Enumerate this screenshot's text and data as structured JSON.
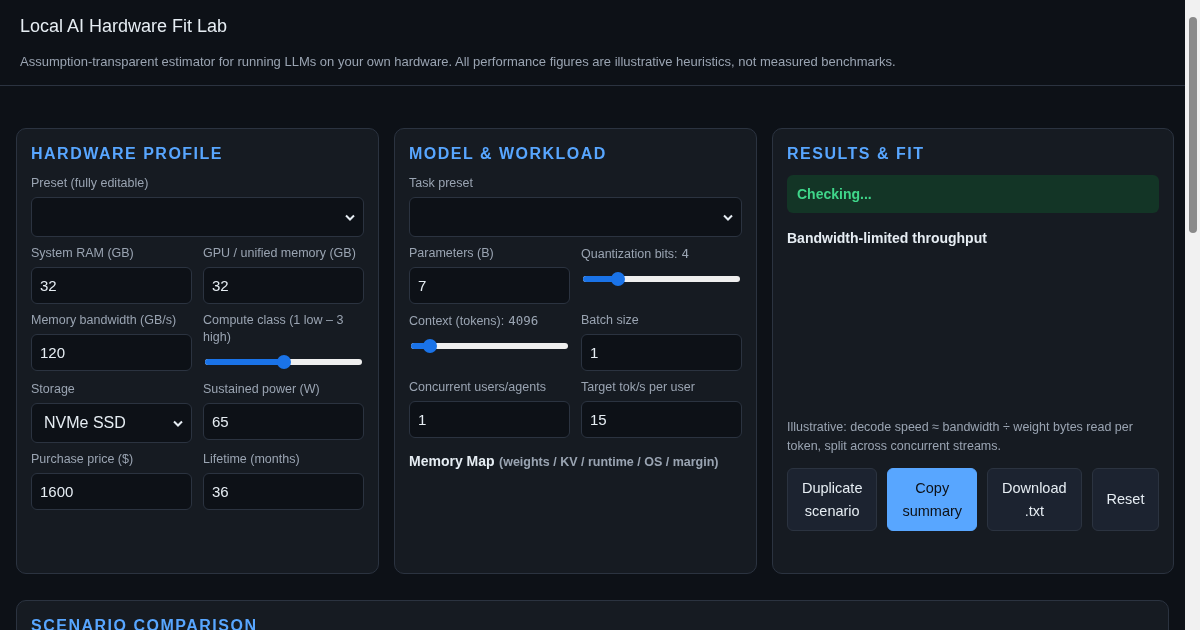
{
  "header": {
    "title": "Local AI Hardware Fit Lab",
    "subtitle": "Assumption-transparent estimator for running LLMs on your own hardware. All performance figures are illustrative heuristics, not measured benchmarks."
  },
  "panels": [
    {
      "title": "HARDWARE PROFILE",
      "fields": [
        {
          "kind": "select",
          "label": "Preset (fully editable)",
          "wide": true
        },
        {
          "kind": "input",
          "label": "System RAM (GB)",
          "value": "32"
        },
        {
          "kind": "input",
          "label": "GPU / unified memory (GB)",
          "value": "32"
        },
        {
          "kind": "input",
          "label": "Memory bandwidth (GB/s)",
          "value": "120"
        },
        {
          "kind": "slider",
          "label": "Compute class (1 low – 3 high)",
          "level": 0.5
        },
        {
          "kind": "select",
          "label": "Storage",
          "value": "NVMe SSD"
        },
        {
          "kind": "input",
          "label": "Sustained power (W)",
          "value": "65"
        },
        {
          "kind": "input",
          "label": "Purchase price ($)",
          "value": "1600"
        },
        {
          "kind": "input",
          "label": "Lifetime (months)",
          "value": "36"
        }
      ]
    },
    {
      "title": "MODEL & WORKLOAD",
      "fields": [
        {
          "kind": "select",
          "label": "Task preset",
          "wide": true
        },
        {
          "kind": "input",
          "label": "Parameters (B)",
          "value": "7"
        },
        {
          "kind": "slider",
          "label": "Quantization bits:",
          "reading": "4",
          "level": 0.22
        },
        {
          "kind": "slider",
          "label": "Context (tokens):",
          "reading": "4096",
          "level": 0.12
        },
        {
          "kind": "input",
          "label": "Batch size",
          "value": "1"
        },
        {
          "kind": "input",
          "label": "Concurrent users/agents",
          "value": "1"
        },
        {
          "kind": "input",
          "label": "Target tok/s per user",
          "value": "15"
        }
      ],
      "memory_map": {
        "title": "Memory Map",
        "note": "(weights / KV / runtime / OS / margin)"
      }
    },
    {
      "title": "RESULTS & FIT",
      "status": "Checking...",
      "subtitle": "Bandwidth-limited throughput",
      "note": "Illustrative: decode speed ≈ bandwidth ÷ weight bytes read per token, split across concurrent streams.",
      "buttons": [
        {
          "label": "Duplicate scenario",
          "primary": false
        },
        {
          "label": "Copy summary",
          "primary": true
        },
        {
          "label": "Download .txt",
          "primary": false
        },
        {
          "label": "Reset",
          "primary": false
        }
      ]
    }
  ],
  "comparison": {
    "title": "SCENARIO COMPARISON"
  }
}
